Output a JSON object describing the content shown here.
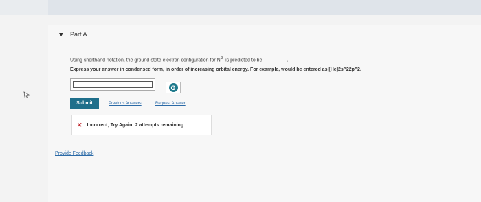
{
  "part": {
    "title": "Part A"
  },
  "question": {
    "prefix": "Using shorthand notation, the ground-state electron configuration for N",
    "superscript": "3-",
    "suffix": "is predicted to be",
    "trailing": "."
  },
  "instruction": {
    "text": "Express your answer in condensed form, in order of increasing orbital energy. For example, would be entered as [He]2s^22p^2."
  },
  "answer": {
    "value": "",
    "placeholder": ""
  },
  "tool_button": {
    "label": "G"
  },
  "actions": {
    "submit": "Submit",
    "previous_answers": "Previous Answers",
    "request_answer": "Request Answer"
  },
  "feedback": {
    "icon": "x-icon",
    "message": "Incorrect; Try Again; 2 attempts remaining"
  },
  "footer": {
    "provide_feedback": "Provide Feedback"
  },
  "colors": {
    "accent": "#1f6f8b",
    "error": "#c0272d",
    "link": "#2b6aa7"
  }
}
